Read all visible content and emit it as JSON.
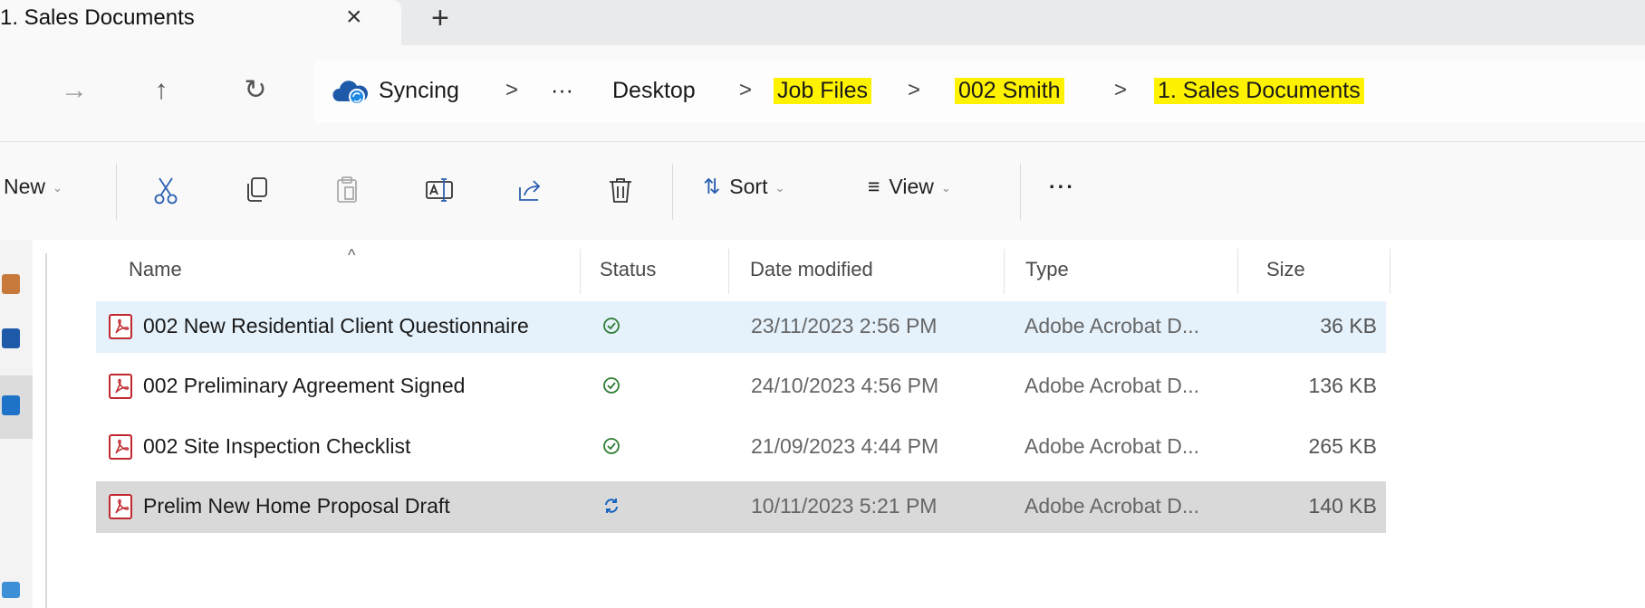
{
  "tab": {
    "title": "1. Sales Documents",
    "close_glyph": "×",
    "new_tab_glyph": "+"
  },
  "nav": {
    "forward_glyph": "→",
    "up_glyph": "↑",
    "refresh_glyph": "↻"
  },
  "breadcrumb": {
    "items": [
      "Syncing",
      "···",
      "Desktop",
      "Job Files",
      "002 Smith",
      "1. Sales Documents"
    ],
    "separator": ">",
    "highlight_color": "#fff200",
    "cloud_icon": "onedrive-syncing-icon"
  },
  "toolbar": {
    "new_label": "New",
    "sort_label": "Sort",
    "view_label": "View",
    "more_label": "···",
    "icons": [
      "cut-icon",
      "copy-icon",
      "paste-icon",
      "rename-icon",
      "share-icon",
      "delete-icon"
    ]
  },
  "columns": {
    "name": "Name",
    "status": "Status",
    "date": "Date modified",
    "type": "Type",
    "size": "Size"
  },
  "files": [
    {
      "name": "002 New Residential Client Questionnaire",
      "status": "synced",
      "date": "23/11/2023 2:56 PM",
      "type": "Adobe Acrobat D...",
      "size": "36 KB",
      "state": "selected"
    },
    {
      "name": "002 Preliminary Agreement Signed",
      "status": "synced",
      "date": "24/10/2023 4:56 PM",
      "type": "Adobe Acrobat D...",
      "size": "136 KB",
      "state": "normal"
    },
    {
      "name": "002 Site Inspection Checklist",
      "status": "synced",
      "date": "21/09/2023 4:44 PM",
      "type": "Adobe Acrobat D...",
      "size": "265 KB",
      "state": "normal"
    },
    {
      "name": "Prelim New Home Proposal Draft",
      "status": "syncing",
      "date": "10/11/2023 5:21 PM",
      "type": "Adobe Acrobat D...",
      "size": "140 KB",
      "state": "hover"
    }
  ],
  "colors": {
    "pdf_red": "#c1272d",
    "synced_green": "#2e7d32",
    "syncing_blue": "#1565c0",
    "selected_bg": "#e5f1fb",
    "hover_bg": "#d9d9d9"
  }
}
